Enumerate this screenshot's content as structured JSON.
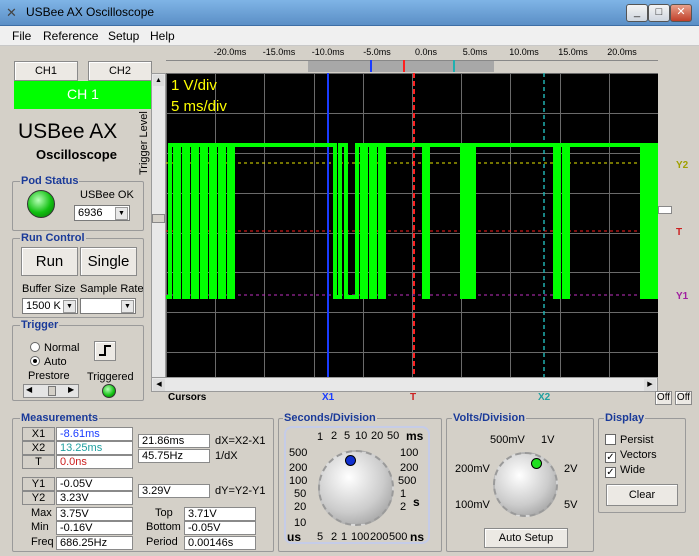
{
  "window": {
    "title": "USBee AX Oscilloscope"
  },
  "menu": [
    "File",
    "Reference",
    "Setup",
    "Help"
  ],
  "channels": {
    "ch1_tab": "CH1",
    "ch2_tab": "CH2",
    "active_label": "CH 1",
    "active_color": "#00ff00"
  },
  "brand": {
    "name": "USBee AX",
    "subtitle": "Oscilloscope"
  },
  "trigger_level_label": "Trigger Level",
  "pod_status": {
    "title": "Pod Status",
    "status": "USBee OK",
    "pod_id": "6936"
  },
  "run_control": {
    "title": "Run Control",
    "run": "Run",
    "single": "Single",
    "buffer_label": "Buffer Size",
    "buffer_value": "1500 K",
    "sample_label": "Sample Rate",
    "sample_value": ""
  },
  "trigger": {
    "title": "Trigger",
    "normal": "Normal",
    "auto": "Auto",
    "prestore": "Prestore",
    "triggered": "Triggered"
  },
  "time_axis": [
    "-20.0ms",
    "-15.0ms",
    "-10.0ms",
    "-5.0ms",
    "0.0ns",
    "5.0ms",
    "10.0ms",
    "15.0ms",
    "20.0ms"
  ],
  "scope": {
    "volts_label": "1 V/div",
    "time_label": "5 ms/div",
    "right_labels": {
      "y2": "Y2",
      "t": "T",
      "y1": "Y1"
    },
    "trace_color": "#00ff00",
    "cursor_colors": {
      "x1": "#1a3cff",
      "t": "#ff2020",
      "x2": "#20b0b0",
      "y2": "#e8e800",
      "y1": "#c030c0"
    }
  },
  "cursors_bar": {
    "label": "Cursors",
    "x1": "X1",
    "t": "T",
    "x2": "X2",
    "off1": "Off",
    "off2": "Off"
  },
  "measurements": {
    "title": "Measurements",
    "x1_label": "X1",
    "x1": "-8.61ms",
    "x2_label": "X2",
    "x2": "13.25ms",
    "t_label": "T",
    "t": "0.0ns",
    "dx_value": "21.86ms",
    "dx_label": "dX=X2-X1",
    "freq_value": "45.75Hz",
    "freq_label": "1/dX",
    "y1_label": "Y1",
    "y1": "-0.05V",
    "y2_label": "Y2",
    "y2": "3.23V",
    "dy_value": "3.29V",
    "dy_label": "dY=Y2-Y1",
    "max_label": "Max",
    "max": "3.75V",
    "min_label": "Min",
    "min": "-0.16V",
    "freqm_label": "Freq",
    "freqm": "686.25Hz",
    "top_label": "Top",
    "top": "3.71V",
    "bottom_label": "Bottom",
    "bottom": "-0.05V",
    "period_label": "Period",
    "period": "0.00146s"
  },
  "seconds_division": {
    "title": "Seconds/Division",
    "ms_scale": [
      "1",
      "2",
      "5",
      "10",
      "20",
      "50"
    ],
    "ms_unit": "ms",
    "left_scale": [
      "500",
      "200",
      "100",
      "50",
      "20",
      "10"
    ],
    "left_unit": "us",
    "right_scale": [
      "100",
      "200",
      "500",
      "1",
      "2"
    ],
    "right_unit": "s",
    "bottom_scale": [
      "5",
      "2",
      "1",
      "100",
      "200",
      "500"
    ],
    "bottom_unit": "ns"
  },
  "volts_division": {
    "title": "Volts/Division",
    "v500mv": "500mV",
    "v1": "1V",
    "v200mv": "200mV",
    "v2": "2V",
    "v100mv": "100mV",
    "v5": "5V",
    "auto_setup": "Auto Setup"
  },
  "display": {
    "title": "Display",
    "persist": "Persist",
    "vectors": "Vectors",
    "wide": "Wide",
    "clear": "Clear"
  }
}
